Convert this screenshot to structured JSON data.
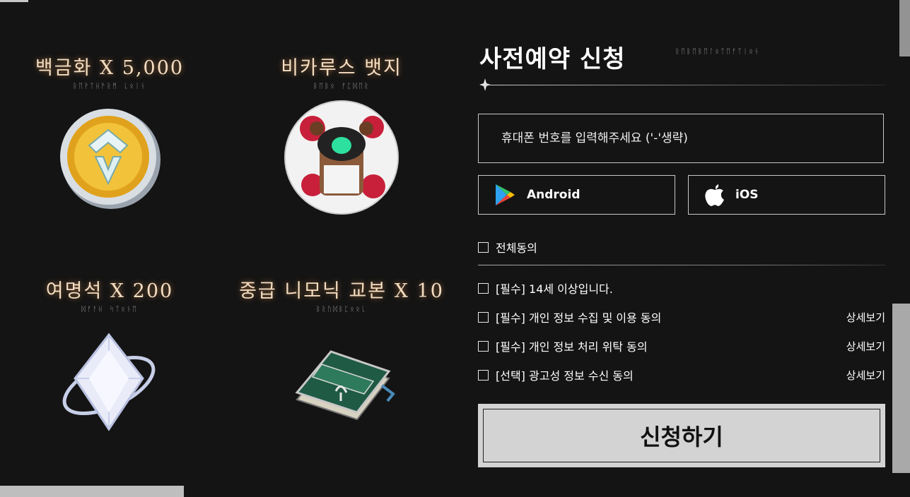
{
  "rewards": [
    {
      "title": "백금화 X 5,000",
      "subtitle": "ᚱᛖᚹᛏᚺᚫᚱᛗ ᚳᛟᛁᚾ",
      "icon": "platinum-coin-icon"
    },
    {
      "title": "비카루스 뱃지",
      "subtitle": "ᛒᛖᛒᛟ ᚠᛈᛞᛖᚱ",
      "icon": "vicarus-badge-icon"
    },
    {
      "title": "여명석 X 200",
      "subtitle": "ᛞᚠᚨᚺ ᛋᛏᛟᚾᛖ",
      "icon": "dawn-stone-icon"
    },
    {
      "title": "중급 니모닉 교본 X 10",
      "subtitle": "ᛒᚱᚢᛞᛒᛈᛟᛟᚳ",
      "icon": "mnemonic-book-icon"
    }
  ],
  "panel": {
    "title": "사전예약 신청",
    "subtitle": "ᚱᛖᛒᛖᛒᛖᛚᛟᛏᛖᚠᛏᛁᛟᚾ",
    "phone_placeholder": "휴대폰 번호를 입력해주세요 ('-'생략)",
    "android_label": "Android",
    "ios_label": "iOS",
    "agree_all": "전체동의",
    "terms": [
      {
        "label": "[필수] 14세 이상입니다.",
        "detail": ""
      },
      {
        "label": "[필수] 개인 정보 수집 및 이용 동의",
        "detail": "상세보기"
      },
      {
        "label": "[필수] 개인 정보 처리 위탁 동의",
        "detail": "상세보기"
      },
      {
        "label": "[선택] 광고성 정보 수신 동의",
        "detail": "상세보기"
      }
    ],
    "submit_label": "신청하기"
  },
  "colors": {
    "background": "#141414",
    "title_glow": "#f3dcc0",
    "submit_bg": "#d3d3d3"
  }
}
